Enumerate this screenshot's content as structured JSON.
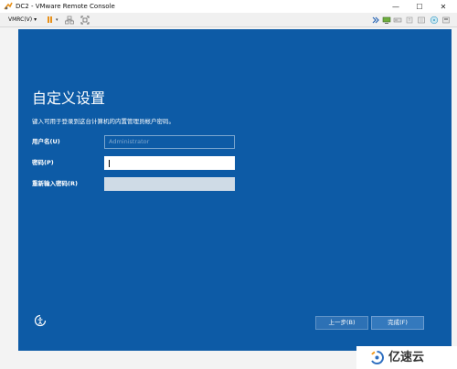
{
  "window": {
    "title": "DC2 - VMware Remote Console",
    "menu_label": "VMRC(V)",
    "menu_caret": "▾",
    "min_glyph": "—",
    "max_glyph": "☐",
    "close_glyph": "✕"
  },
  "toolbar": {
    "pause_caret": "▾",
    "icons": [
      "pause-icon",
      "network-icon",
      "fit-screen-icon",
      "forward-icon",
      "monitor-icon",
      "cd-drive-icon",
      "usb-icon",
      "network-adapter-icon",
      "floppy-icon"
    ]
  },
  "setup": {
    "heading": "自定义设置",
    "subtitle": "键入可用于登录到这台计算机的内置管理员帐户密码。",
    "username_label": "用户名(U)",
    "username_value": "Administrator",
    "password_label": "密码(P)",
    "confirm_label": "重新输入密码(R)",
    "back_button": "上一步(B)",
    "finish_button": "完成(F)"
  },
  "watermark": {
    "text": "亿速云"
  },
  "colors": {
    "screen_bg": "#0d5ba6",
    "button_bg": "#2d71b5",
    "pause_accent": "#e8911a"
  }
}
